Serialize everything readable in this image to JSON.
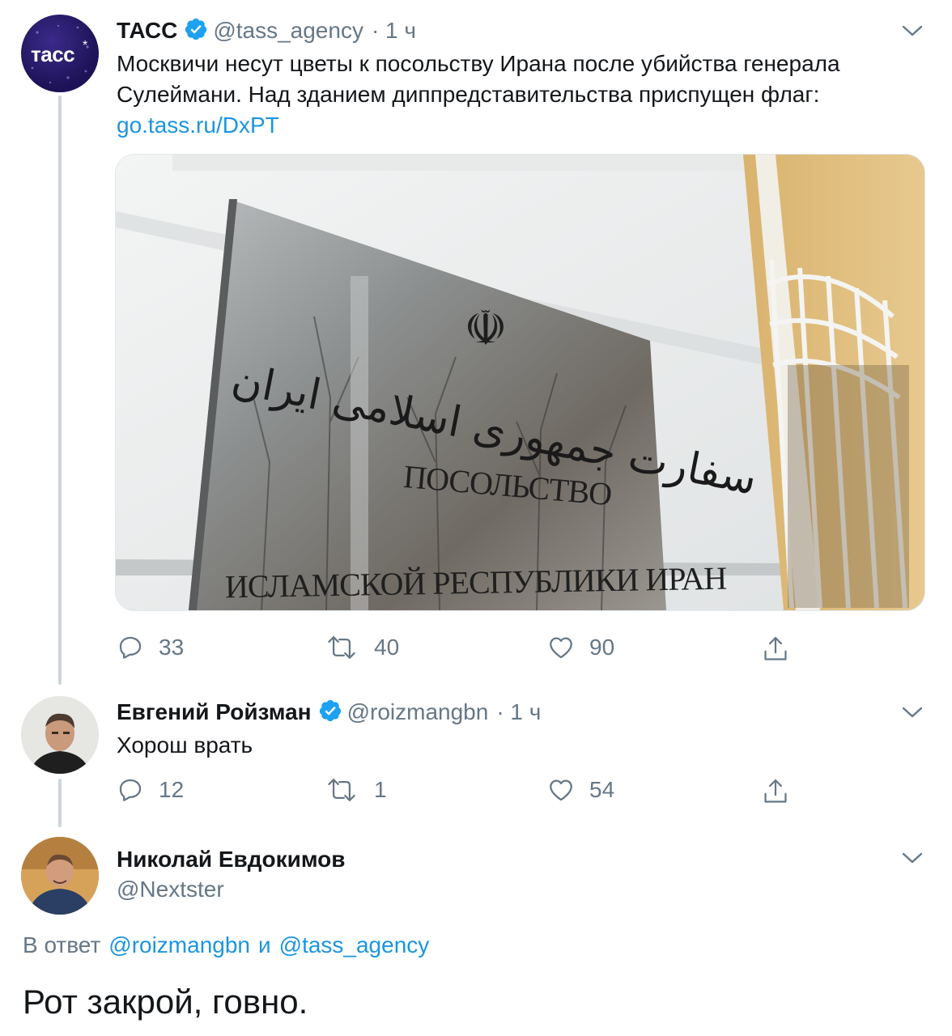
{
  "tweet1": {
    "name": "ТАСС",
    "handle": "@tass_agency",
    "time": "· 1 ч",
    "avatar_label": "тасс",
    "text": "Москвичи несут цветы к посольству Ирана после убийства генерала Сулеймани. Над зданием диппредставительства приспущен флаг:",
    "link": "go.tass.ru/DxPT",
    "photo": {
      "plaque_line1": "ПОСОЛЬСТВО",
      "plaque_line2": "ИСЛАМСКОЙ РЕСПУБЛИКИ ИРАН",
      "plaque_farsi": "سفارت جمهوری اسلامی ایران"
    },
    "actions": {
      "reply": "33",
      "retweet": "40",
      "like": "90"
    }
  },
  "tweet2": {
    "name": "Евгений Ройзман",
    "handle": "@roizmangbn",
    "time": "· 1 ч",
    "text": "Хорош врать",
    "actions": {
      "reply": "12",
      "retweet": "1",
      "like": "54"
    }
  },
  "tweet3": {
    "name": "Николай Евдокимов",
    "handle": "@Nextster",
    "reply_prefix": "В ответ",
    "reply_user1": "@roizmangbn",
    "reply_and": "и",
    "reply_user2": "@tass_agency",
    "text": "Рот закрой, говно."
  },
  "colors": {
    "accent": "#1b95e0",
    "muted": "#657786",
    "line": "#ccd6dd",
    "verified": "#1da1f2"
  }
}
